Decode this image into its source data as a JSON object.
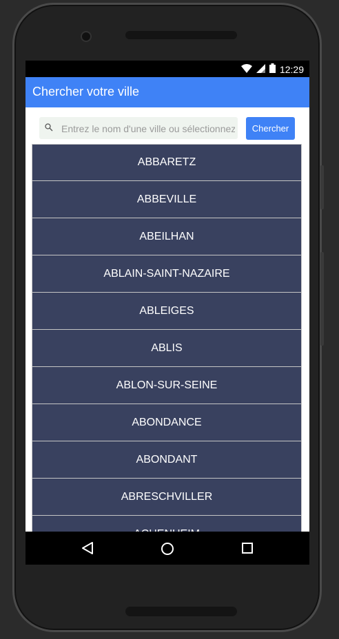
{
  "status_bar": {
    "time": "12:29"
  },
  "app_bar": {
    "title": "Chercher votre ville"
  },
  "search": {
    "placeholder": "Entrez le nom d'une ville ou sélectionnez",
    "value": "",
    "button_label": "Chercher"
  },
  "cities": [
    "ABBARETZ",
    "ABBEVILLE",
    "ABEILHAN",
    "ABLAIN-SAINT-NAZAIRE",
    "ABLEIGES",
    "ABLIS",
    "ABLON-SUR-SEINE",
    "ABONDANCE",
    "ABONDANT",
    "ABRESCHVILLER",
    "ACHENHEIM"
  ],
  "icons": {
    "wifi": "wifi-icon",
    "signal": "signal-icon",
    "battery": "battery-icon",
    "search": "search-icon",
    "back": "back-icon",
    "home": "home-icon",
    "recent": "recent-apps-icon"
  },
  "colors": {
    "app_bar": "#3f82f6",
    "list_item": "#39415f",
    "search_bg": "#eff4ef"
  }
}
